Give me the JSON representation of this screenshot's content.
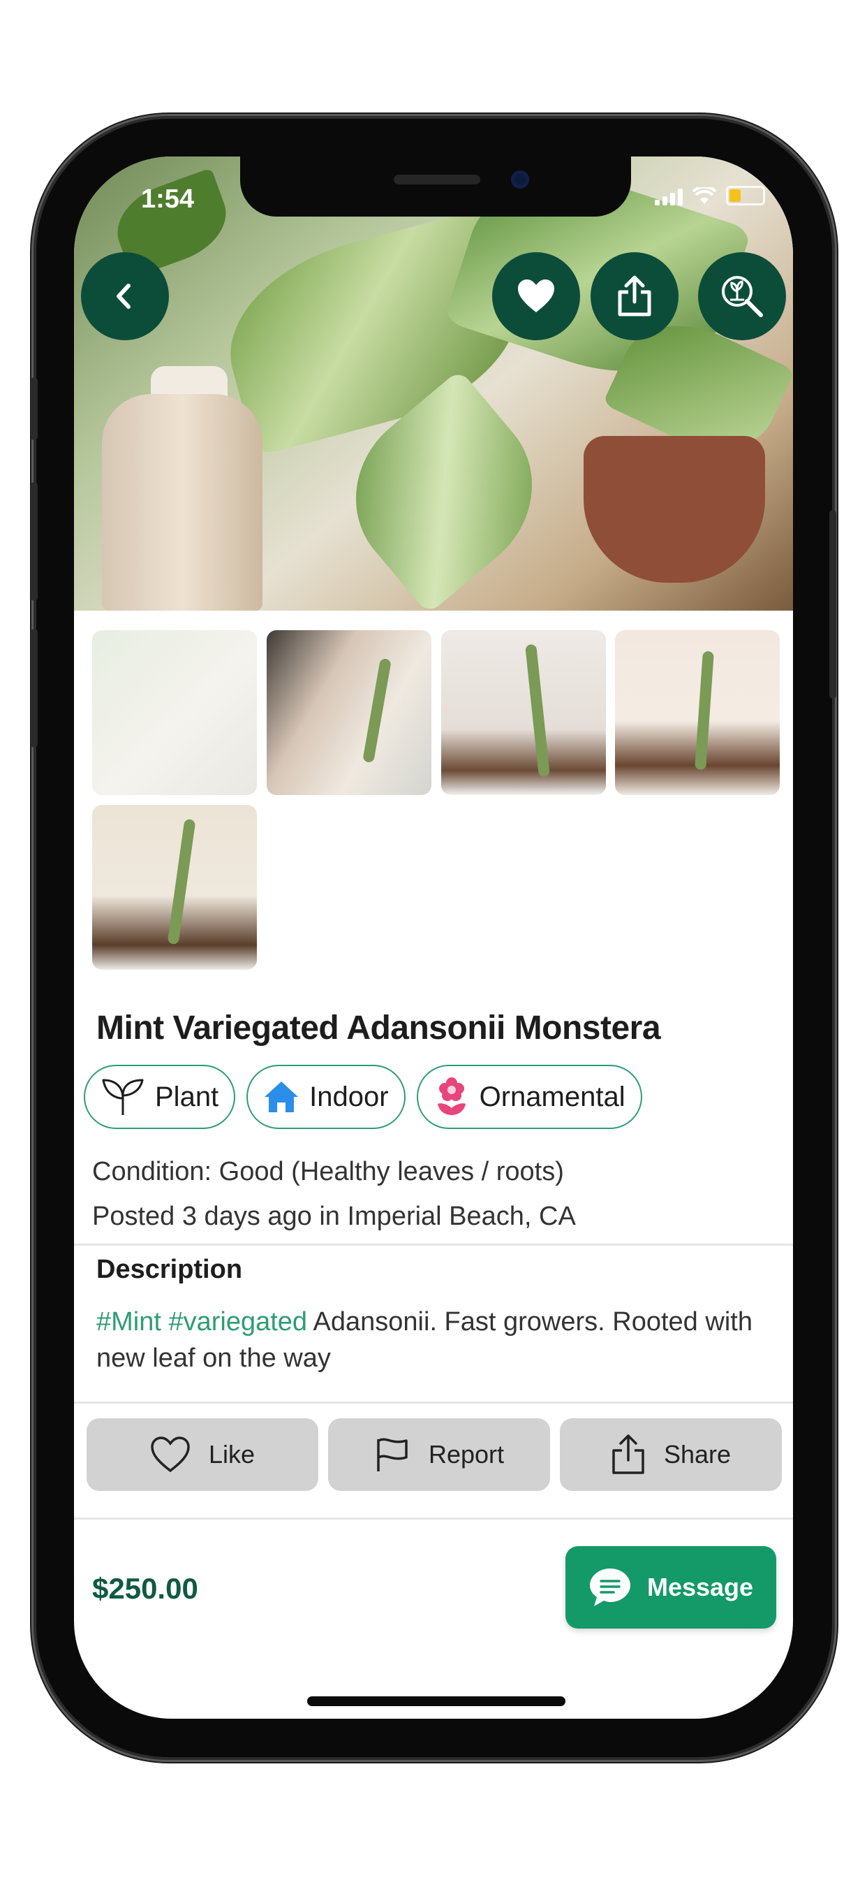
{
  "status_bar": {
    "time": "1:54"
  },
  "hero": {
    "back_icon": "chevron-left-icon",
    "favorite_icon": "heart-icon",
    "share_icon": "share-icon",
    "identify_icon": "plant-search-icon"
  },
  "listing": {
    "title": "Mint Variegated Adansonii Monstera",
    "chips": [
      {
        "label": "Plant",
        "icon": "sprout-icon"
      },
      {
        "label": "Indoor",
        "icon": "house-icon"
      },
      {
        "label": "Ornamental",
        "icon": "flower-icon"
      }
    ],
    "condition": "Condition: Good (Healthy leaves / roots)",
    "posted": "Posted 3 days ago in Imperial Beach, CA",
    "description_heading": "Description",
    "description_tags": "#Mint #variegated",
    "description_text": " Adansonii. Fast growers. Rooted with new leaf on the way"
  },
  "actions": {
    "like": "Like",
    "report": "Report",
    "share": "Share"
  },
  "footer": {
    "price": "$250.00",
    "message_button": "Message"
  },
  "colors": {
    "brand_dark": "#0c4d3a",
    "accent": "#139a68",
    "tag": "#2e9c74"
  }
}
